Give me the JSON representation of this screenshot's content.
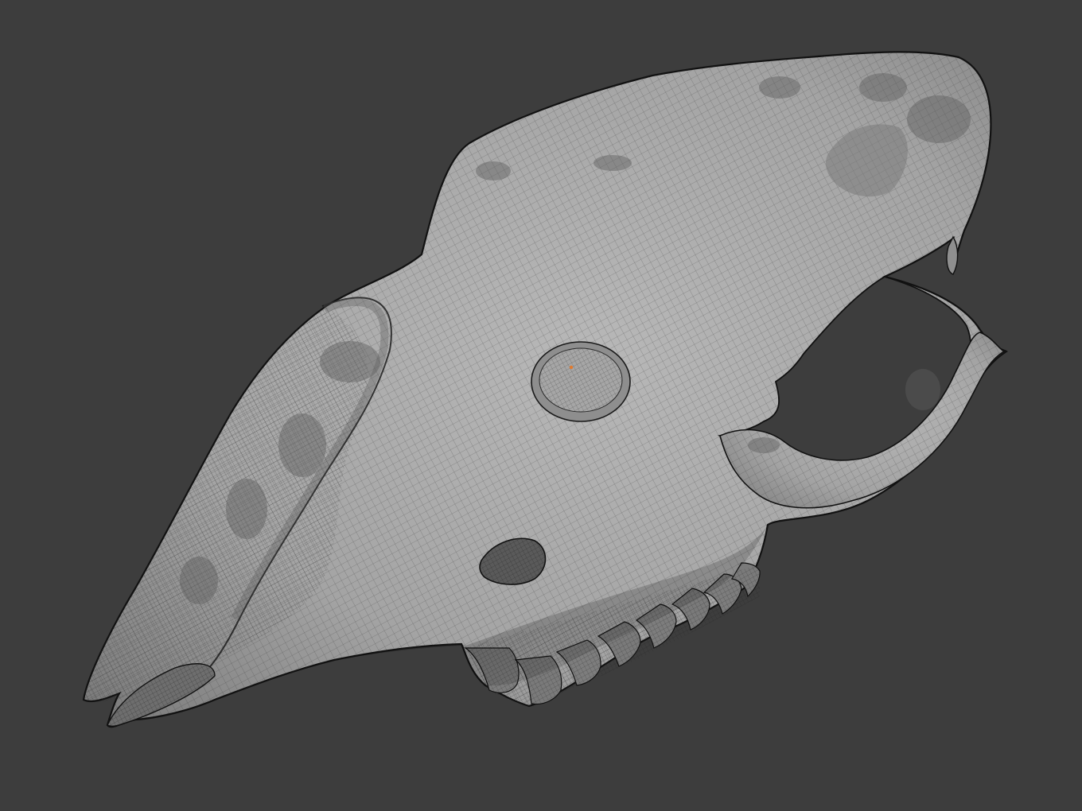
{
  "viewport": {
    "background_color": "#3d3d3d",
    "shading_mode": "wireframe-over-solid",
    "object": {
      "type": "skull-mesh",
      "base_color": "#a9a9a9",
      "wire_color": "#2b2b2b",
      "outline_color": "#111111",
      "selected_vertex_color": "#e07a2e"
    }
  }
}
